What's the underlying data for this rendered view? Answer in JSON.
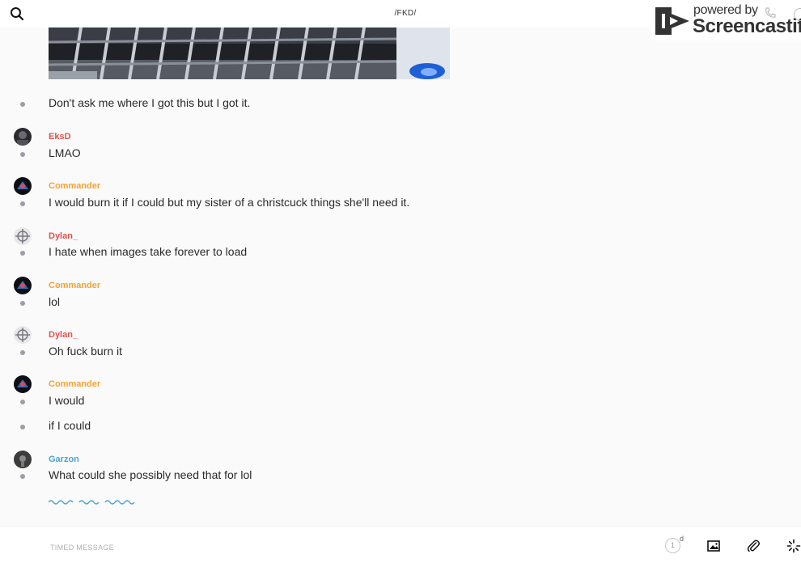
{
  "header": {
    "title": "/FKD/",
    "search_icon": "search-icon"
  },
  "watermark": {
    "line1": "powered by",
    "line2": "Screencastify"
  },
  "feed": {
    "messages": [
      {
        "text": "Don't ask me where I got this but I got it."
      },
      {
        "username": "EksD",
        "username_color": "#e0534a",
        "text": "LMAO"
      },
      {
        "username": "Commander",
        "username_color": "#f5a234",
        "text": "I would burn it if I could but my sister of a christcuck things she'll need it."
      },
      {
        "username": "Dylan_",
        "username_color": "#e0534a",
        "text": "I hate when images take forever to load"
      },
      {
        "username": "Commander",
        "username_color": "#f5a234",
        "text": "lol"
      },
      {
        "username": "Dylan_",
        "username_color": "#e0534a",
        "text": "Oh fuck burn it"
      },
      {
        "username": "Commander",
        "username_color": "#f5a234",
        "text": "I would"
      },
      {
        "text": "if I could"
      },
      {
        "username": "Garzon",
        "username_color": "#4aa3d6",
        "text": "What could she possibly need that for lol"
      }
    ]
  },
  "composer": {
    "placeholder": "TIMED MESSAGE",
    "timer_value": "1",
    "timer_unit": "d",
    "icons": [
      "image-icon",
      "paperclip-icon",
      "spinner-icon"
    ]
  },
  "colors": {
    "accent_blue": "#4aa3d6",
    "bullet": "#9a9ea5",
    "username_red": "#e0534a",
    "username_orange": "#f5a234"
  }
}
